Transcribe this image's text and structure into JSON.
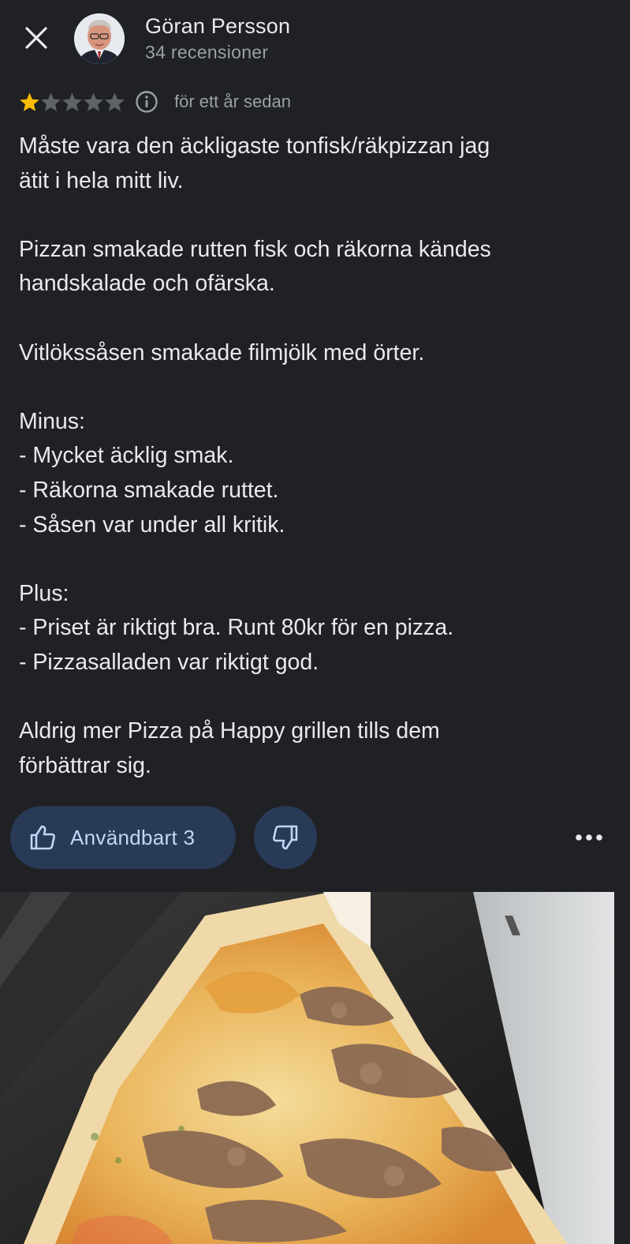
{
  "header": {
    "close_icon": "close-icon",
    "author_name": "Göran Persson",
    "review_count": "34 recensioner"
  },
  "rating": {
    "stars": 1,
    "max_stars": 5,
    "info_icon": "info-icon",
    "time_ago": "för ett år sedan"
  },
  "review": {
    "paragraphs": [
      [
        "Måste vara den äckligaste tonfisk/räkpizzan jag",
        "ätit i hela mitt liv."
      ],
      [
        "Pizzan smakade rutten fisk och räkorna kändes",
        "handskalade och ofärska."
      ],
      [
        "Vitlökssåsen smakade filmjölk med örter."
      ],
      [
        "Minus:",
        "- Mycket äcklig smak.",
        "- Räkorna smakade ruttet.",
        "- Såsen var under all kritik."
      ],
      [
        "Plus:",
        "- Priset är riktigt bra. Runt 80kr för en pizza.",
        "- Pizzasalladen var riktigt god."
      ],
      [
        "Aldrig mer Pizza på Happy grillen tills dem",
        "förbättrar sig."
      ]
    ]
  },
  "actions": {
    "helpful_label": "Användbart 3",
    "helpful_icon": "thumbs-up-icon",
    "dislike_icon": "thumbs-down-icon",
    "more_icon": "more-horizontal-icon"
  },
  "photo": {
    "subject": "review-photo"
  },
  "colors": {
    "background": "#202125",
    "star_filled": "#fbbc04",
    "star_empty": "#5f6368",
    "button_bg": "#283a56",
    "button_text": "#c2d7f5"
  }
}
